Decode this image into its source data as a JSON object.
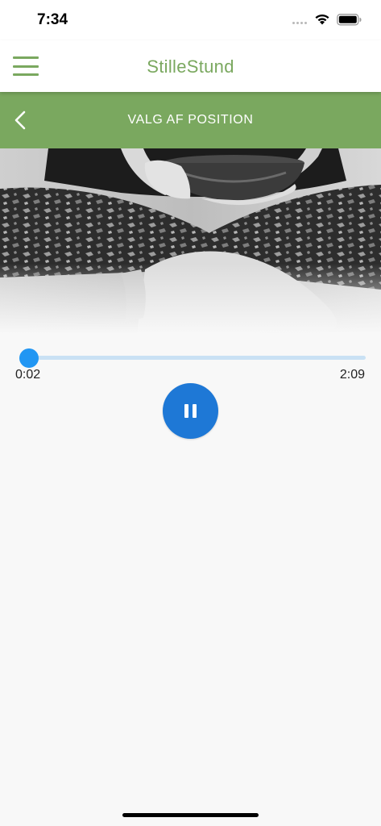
{
  "status_bar": {
    "time": "7:34"
  },
  "header": {
    "title": "StilleStund",
    "menu_icon": "hamburger-menu-icon",
    "accent_color": "#7aa85f"
  },
  "section": {
    "title": "VALG AF POSITION",
    "back_icon": "chevron-left-icon",
    "background_color": "#7aa85f"
  },
  "hero": {
    "image": "meditation-singing-bowl-photo"
  },
  "player": {
    "elapsed": "0:02",
    "total": "2:09",
    "progress_fraction": 0.016,
    "pause_icon": "pause-icon",
    "accent_color": "#1e78d6"
  }
}
